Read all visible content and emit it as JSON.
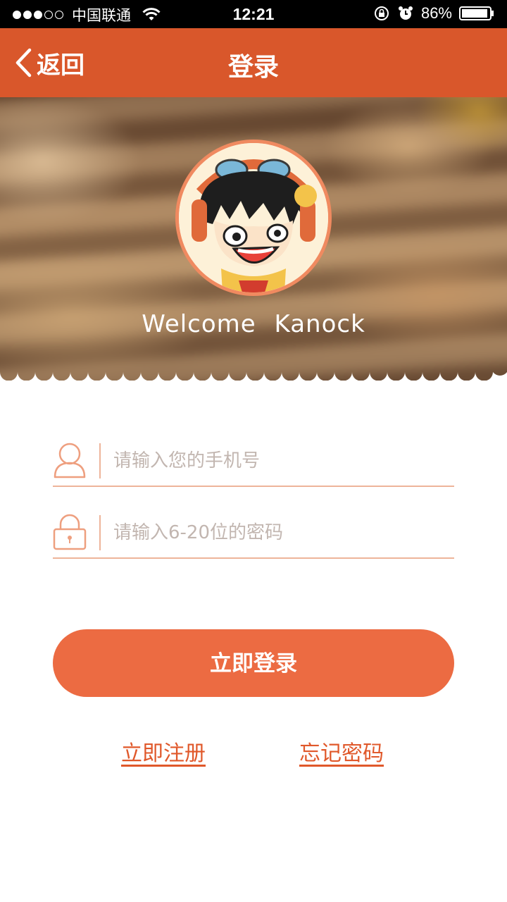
{
  "status_bar": {
    "carrier": "中国联通",
    "time": "12:21",
    "battery": "86%",
    "signal_icon": "signal-dots-icon",
    "wifi_icon": "wifi-icon",
    "rotation_lock_icon": "rotation-lock-icon",
    "alarm_icon": "alarm-icon",
    "battery_icon": "battery-icon"
  },
  "nav": {
    "back_label": "返回",
    "back_icon": "chevron-left-icon",
    "title": "登录",
    "background_color": "#d9572b"
  },
  "hero": {
    "welcome_text": "Welcome  Kanock",
    "avatar": "avatar-cartoon-boy"
  },
  "form": {
    "phone": {
      "icon": "user-icon",
      "placeholder": "请输入您的手机号",
      "value": ""
    },
    "password": {
      "icon": "lock-icon",
      "placeholder": "请输入6-20位的密码",
      "value": ""
    },
    "login_button": "立即登录",
    "register_link": "立即注册",
    "forgot_link": "忘记密码"
  },
  "colors": {
    "accent": "#ec6b42",
    "accent_dark": "#d9572b",
    "underline": "#eeb49a",
    "placeholder": "#c2b6b0"
  }
}
